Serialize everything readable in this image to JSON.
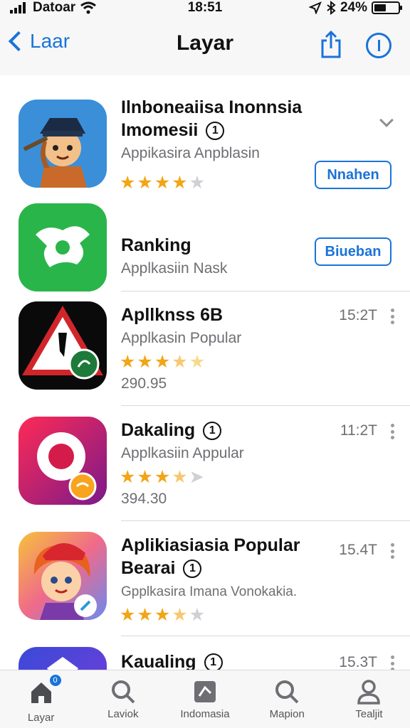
{
  "status_bar": {
    "carrier": "Datoar",
    "time": "18:51",
    "battery": "24%"
  },
  "nav": {
    "back_label": "Laar",
    "title": "Layar"
  },
  "apps": [
    {
      "title": "Ilnboneaiisa Inonnsia",
      "title_line2": "Imomesii",
      "badge": "1",
      "subtitle": "Appikasira Anpblasin",
      "rating": 4,
      "action_label": "Nnahen"
    },
    {
      "title": "Ranking",
      "subtitle": "Applkasiin Nask",
      "action_label": "Biueban"
    },
    {
      "title": "Apllknss 6B",
      "subtitle": "Applkasin Popular",
      "rating": 3.5,
      "price": "290.95",
      "time": "15:2T"
    },
    {
      "title": "Dakaling",
      "badge": "1",
      "subtitle": "Applkasiin Appular",
      "rating": 3.5,
      "price": "394.30",
      "time": "11:2T"
    },
    {
      "title": "Aplikiasiasia Popular",
      "title_line2": "Bearai",
      "badge": "1",
      "subtitle": "Gpplkasira Imana Vonokakia.",
      "rating": 3.5,
      "time": "15.4T"
    },
    {
      "title": "Kaualing",
      "badge": "1",
      "time": "15.3T"
    }
  ],
  "tabs": [
    {
      "label": "Layar",
      "icon": "home-icon",
      "badge": "0"
    },
    {
      "label": "Laviok",
      "icon": "search-icon"
    },
    {
      "label": "Indomasia",
      "icon": "apps-icon"
    },
    {
      "label": "Mapion",
      "icon": "search-icon"
    },
    {
      "label": "Tealjit",
      "icon": "person-icon"
    }
  ],
  "colors": {
    "accent": "#1a73d9",
    "star": "#f2a516"
  }
}
